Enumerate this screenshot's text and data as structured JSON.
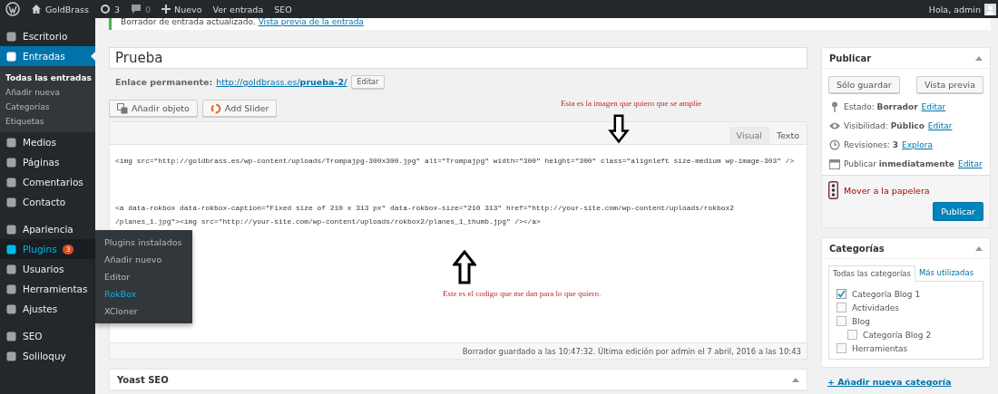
{
  "admin_bar": {
    "site": "GoldBrass",
    "updates": "3",
    "comments": "0",
    "new": "Nuevo",
    "view": "Ver entrada",
    "seo": "SEO",
    "greeting": "Hola, admin"
  },
  "sidebar": {
    "groups": [
      {
        "items": [
          {
            "label": "Escritorio",
            "selected": false
          },
          {
            "label": "Entradas",
            "selected": true,
            "children": [
              {
                "label": "Todas las entradas",
                "selected": true
              },
              {
                "label": "Añadir nueva",
                "selected": false
              },
              {
                "label": "Categorías",
                "selected": false
              },
              {
                "label": "Etiquetas",
                "selected": false
              }
            ]
          },
          {
            "label": "Medios",
            "selected": false
          },
          {
            "label": "Páginas",
            "selected": false
          },
          {
            "label": "Comentarios",
            "selected": false
          },
          {
            "label": "Contacto",
            "selected": false
          }
        ]
      },
      {
        "items": [
          {
            "label": "Apariencia",
            "selected": false
          },
          {
            "label": "Plugins",
            "selected": false,
            "hovered": true,
            "badge": "3",
            "flyout": [
              {
                "label": "Plugins instalados",
                "selected": false
              },
              {
                "label": "Añadir nuevo",
                "selected": false
              },
              {
                "label": "Editor",
                "selected": false
              },
              {
                "label": "RokBox",
                "selected": true
              },
              {
                "label": "XCloner",
                "selected": false
              }
            ]
          },
          {
            "label": "Usuarios",
            "selected": false
          },
          {
            "label": "Herramientas",
            "selected": false
          },
          {
            "label": "Ajustes",
            "selected": false
          }
        ]
      },
      {
        "items": [
          {
            "label": "SEO",
            "selected": false
          },
          {
            "label": "Soliloquy",
            "selected": false
          }
        ]
      }
    ]
  },
  "notice": {
    "text": "Borrador de entrada actualizado.",
    "link": "Vista previa de la entrada"
  },
  "title": "Prueba",
  "permalink": {
    "label": "Enlace permanente:",
    "base": "http://goldbrass.es/",
    "slug": "prueba-2/",
    "button": "Editar"
  },
  "media_buttons": [
    "Añadir objeto",
    "Add Slider"
  ],
  "editor_tabs": [
    {
      "label": "Visual",
      "selected": false
    },
    {
      "label": "Texto",
      "selected": true
    }
  ],
  "code_blocks": [
    [
      "<img src=\"http://goldbrass.es/wp-content/uploads/Trompajpg-300x300.jpg\" alt=\"Trompajpg\" width=\"300\" height=\"300\" class=\"alignleft size-medium wp-image-303\" />"
    ],
    [
      "<a data-rokbox data-rokbox-caption=\"Fixed size of 210 x 313 px\" data-rokbox-size=\"210 313\" href=\"http://your-site.com/wp-content/uploads/rokbox2",
      "/planes_1.jpg\"><img src=\"http://your-site.com/wp-content/uploads/rokbox2/planes_1_thumb.jpg\" /></a>"
    ]
  ],
  "annotations": [
    {
      "text": "Esta es la imagen que quiero que se amplie",
      "kind": "down"
    },
    {
      "text": "Este es el codigo que me dan para lo que quiero.",
      "kind": "up"
    }
  ],
  "editor_status": "Borrador guardado a las 10:47:32. Última edición por admin el 7 abril, 2016 a las 10:43",
  "yoast": {
    "title": "Yoast SEO"
  },
  "publish": {
    "title": "Publicar",
    "save": "Sólo guardar",
    "preview": "Vista previa",
    "rows": [
      {
        "label": "Estado:",
        "value": "Borrador",
        "link": "Editar"
      },
      {
        "label": "Visibilidad:",
        "value": "Público",
        "link": "Editar"
      },
      {
        "label": "Revisiones:",
        "value": "3",
        "link": "Explora"
      },
      {
        "label": "Publicar",
        "value": "inmediatamente",
        "link": "Editar"
      }
    ],
    "trash": "Mover a la papelera",
    "button": "Publicar"
  },
  "categories": {
    "title": "Categorías",
    "tabs": [
      {
        "label": "Todas las categorías",
        "selected": true
      },
      {
        "label": "Más utilizadas",
        "selected": false
      }
    ],
    "items": [
      {
        "label": "Categoría Blog 1",
        "checked": true
      },
      {
        "label": "Actividades",
        "checked": false
      },
      {
        "label": "Blog",
        "checked": false,
        "children": [
          {
            "label": "Categoría Blog 2",
            "checked": false
          }
        ]
      },
      {
        "label": "Herramientas",
        "checked": false
      }
    ],
    "add_link": "+ Añadir nueva categoría"
  }
}
